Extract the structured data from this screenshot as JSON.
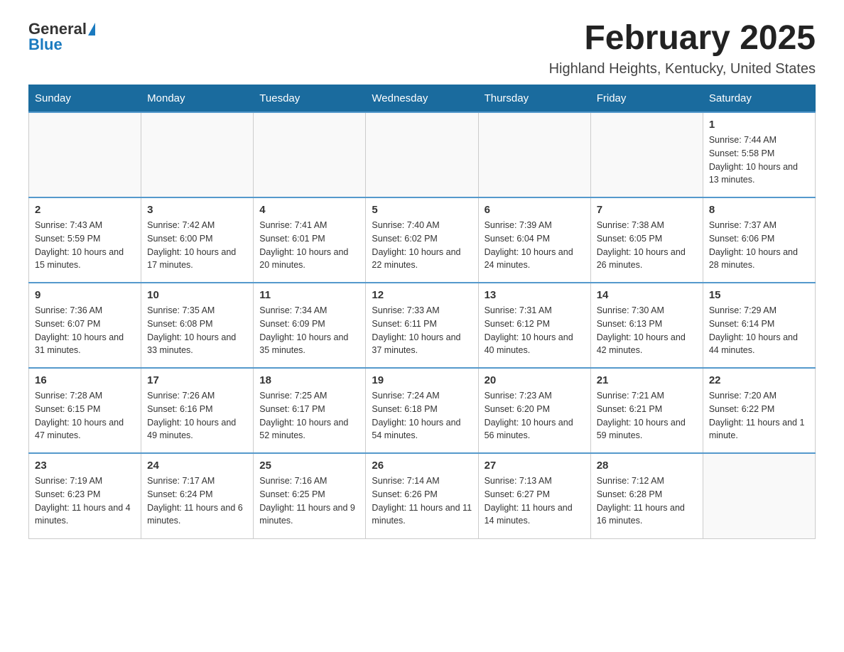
{
  "logo": {
    "general": "General",
    "blue": "Blue"
  },
  "title": {
    "month_year": "February 2025",
    "location": "Highland Heights, Kentucky, United States"
  },
  "days_of_week": [
    "Sunday",
    "Monday",
    "Tuesday",
    "Wednesday",
    "Thursday",
    "Friday",
    "Saturday"
  ],
  "weeks": [
    [
      {
        "day": "",
        "info": ""
      },
      {
        "day": "",
        "info": ""
      },
      {
        "day": "",
        "info": ""
      },
      {
        "day": "",
        "info": ""
      },
      {
        "day": "",
        "info": ""
      },
      {
        "day": "",
        "info": ""
      },
      {
        "day": "1",
        "info": "Sunrise: 7:44 AM\nSunset: 5:58 PM\nDaylight: 10 hours and 13 minutes."
      }
    ],
    [
      {
        "day": "2",
        "info": "Sunrise: 7:43 AM\nSunset: 5:59 PM\nDaylight: 10 hours and 15 minutes."
      },
      {
        "day": "3",
        "info": "Sunrise: 7:42 AM\nSunset: 6:00 PM\nDaylight: 10 hours and 17 minutes."
      },
      {
        "day": "4",
        "info": "Sunrise: 7:41 AM\nSunset: 6:01 PM\nDaylight: 10 hours and 20 minutes."
      },
      {
        "day": "5",
        "info": "Sunrise: 7:40 AM\nSunset: 6:02 PM\nDaylight: 10 hours and 22 minutes."
      },
      {
        "day": "6",
        "info": "Sunrise: 7:39 AM\nSunset: 6:04 PM\nDaylight: 10 hours and 24 minutes."
      },
      {
        "day": "7",
        "info": "Sunrise: 7:38 AM\nSunset: 6:05 PM\nDaylight: 10 hours and 26 minutes."
      },
      {
        "day": "8",
        "info": "Sunrise: 7:37 AM\nSunset: 6:06 PM\nDaylight: 10 hours and 28 minutes."
      }
    ],
    [
      {
        "day": "9",
        "info": "Sunrise: 7:36 AM\nSunset: 6:07 PM\nDaylight: 10 hours and 31 minutes."
      },
      {
        "day": "10",
        "info": "Sunrise: 7:35 AM\nSunset: 6:08 PM\nDaylight: 10 hours and 33 minutes."
      },
      {
        "day": "11",
        "info": "Sunrise: 7:34 AM\nSunset: 6:09 PM\nDaylight: 10 hours and 35 minutes."
      },
      {
        "day": "12",
        "info": "Sunrise: 7:33 AM\nSunset: 6:11 PM\nDaylight: 10 hours and 37 minutes."
      },
      {
        "day": "13",
        "info": "Sunrise: 7:31 AM\nSunset: 6:12 PM\nDaylight: 10 hours and 40 minutes."
      },
      {
        "day": "14",
        "info": "Sunrise: 7:30 AM\nSunset: 6:13 PM\nDaylight: 10 hours and 42 minutes."
      },
      {
        "day": "15",
        "info": "Sunrise: 7:29 AM\nSunset: 6:14 PM\nDaylight: 10 hours and 44 minutes."
      }
    ],
    [
      {
        "day": "16",
        "info": "Sunrise: 7:28 AM\nSunset: 6:15 PM\nDaylight: 10 hours and 47 minutes."
      },
      {
        "day": "17",
        "info": "Sunrise: 7:26 AM\nSunset: 6:16 PM\nDaylight: 10 hours and 49 minutes."
      },
      {
        "day": "18",
        "info": "Sunrise: 7:25 AM\nSunset: 6:17 PM\nDaylight: 10 hours and 52 minutes."
      },
      {
        "day": "19",
        "info": "Sunrise: 7:24 AM\nSunset: 6:18 PM\nDaylight: 10 hours and 54 minutes."
      },
      {
        "day": "20",
        "info": "Sunrise: 7:23 AM\nSunset: 6:20 PM\nDaylight: 10 hours and 56 minutes."
      },
      {
        "day": "21",
        "info": "Sunrise: 7:21 AM\nSunset: 6:21 PM\nDaylight: 10 hours and 59 minutes."
      },
      {
        "day": "22",
        "info": "Sunrise: 7:20 AM\nSunset: 6:22 PM\nDaylight: 11 hours and 1 minute."
      }
    ],
    [
      {
        "day": "23",
        "info": "Sunrise: 7:19 AM\nSunset: 6:23 PM\nDaylight: 11 hours and 4 minutes."
      },
      {
        "day": "24",
        "info": "Sunrise: 7:17 AM\nSunset: 6:24 PM\nDaylight: 11 hours and 6 minutes."
      },
      {
        "day": "25",
        "info": "Sunrise: 7:16 AM\nSunset: 6:25 PM\nDaylight: 11 hours and 9 minutes."
      },
      {
        "day": "26",
        "info": "Sunrise: 7:14 AM\nSunset: 6:26 PM\nDaylight: 11 hours and 11 minutes."
      },
      {
        "day": "27",
        "info": "Sunrise: 7:13 AM\nSunset: 6:27 PM\nDaylight: 11 hours and 14 minutes."
      },
      {
        "day": "28",
        "info": "Sunrise: 7:12 AM\nSunset: 6:28 PM\nDaylight: 11 hours and 16 minutes."
      },
      {
        "day": "",
        "info": ""
      }
    ]
  ]
}
